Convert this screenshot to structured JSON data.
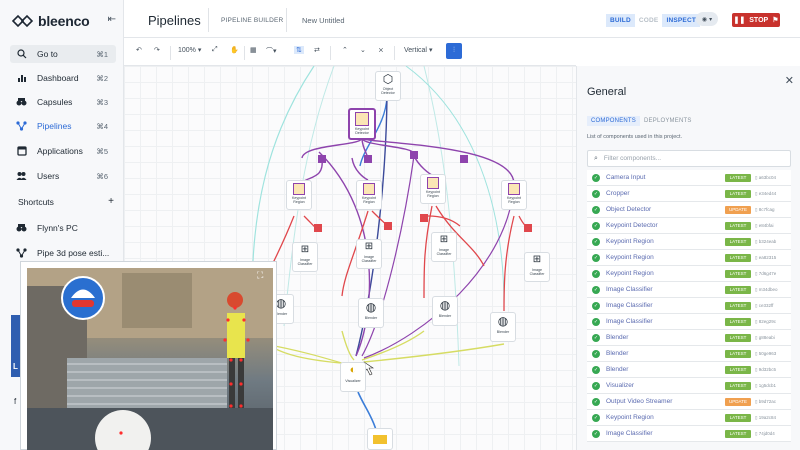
{
  "app": {
    "name": "bleenco"
  },
  "sidebar": {
    "items": [
      {
        "label": "Go to",
        "shortcut": "⌘1"
      },
      {
        "label": "Dashboard",
        "shortcut": "⌘2"
      },
      {
        "label": "Capsules",
        "shortcut": "⌘3"
      },
      {
        "label": "Pipelines",
        "shortcut": "⌘4"
      },
      {
        "label": "Applications",
        "shortcut": "⌘5"
      },
      {
        "label": "Users",
        "shortcut": "⌘6"
      }
    ],
    "shortcuts_label": "Shortcuts",
    "shortcuts_add": "+",
    "shortcuts": [
      {
        "label": "Flynn's PC"
      },
      {
        "label": "Pipe 3d pose esti..."
      }
    ],
    "partial_letter": "f"
  },
  "header": {
    "title": "Pipelines",
    "builder_label": "PIPELINE BUILDER",
    "doc_name": "New Untitled",
    "modes": [
      "BUILD",
      "CODE",
      "INSPECT"
    ],
    "stop_label": "STOP"
  },
  "toolbar": {
    "zoom": "100%",
    "layout": "Vertical"
  },
  "canvas": {
    "nodes": [
      {
        "id": "obj",
        "label": "Object Detector"
      },
      {
        "id": "kpd",
        "label": "Keypoint Detector"
      },
      {
        "id": "kr1",
        "label": "Keypoint Region"
      },
      {
        "id": "kr2",
        "label": "Keypoint Region"
      },
      {
        "id": "kr3",
        "label": "Keypoint Region"
      },
      {
        "id": "kr4",
        "label": "Keypoint Region"
      },
      {
        "id": "ic1",
        "label": "Image Classifier"
      },
      {
        "id": "ic2",
        "label": "Image Classifier"
      },
      {
        "id": "ic3",
        "label": "Image Classifier"
      },
      {
        "id": "ic4",
        "label": "Image Classifier"
      },
      {
        "id": "bl0",
        "label": "Blender"
      },
      {
        "id": "bl1",
        "label": "Blender"
      },
      {
        "id": "bl2",
        "label": "Blender"
      },
      {
        "id": "bl3",
        "label": "Blender"
      },
      {
        "id": "vis",
        "label": "Visualizer"
      }
    ],
    "colors": {
      "purple": "#8e44ad",
      "red": "#e0474c",
      "blue": "#3b7dd8",
      "yellow": "#d6dc63",
      "teal": "#7fd3d0"
    }
  },
  "panel": {
    "title": "General",
    "tabs": [
      "COMPONENTS",
      "DEPLOYMENTS"
    ],
    "description": "List of components used in this project.",
    "filter_placeholder": "Filter components...",
    "components": [
      {
        "name": "Camera Input",
        "badge": "LATEST",
        "hash": "a63bc04"
      },
      {
        "name": "Cropper",
        "badge": "LATEST",
        "hash": "e34ed44"
      },
      {
        "name": "Object Detector",
        "badge": "UPDATE",
        "hash": "8c7fcag"
      },
      {
        "name": "Keypoint Detector",
        "badge": "LATEST",
        "hash": "e84bfai"
      },
      {
        "name": "Keypoint Region",
        "badge": "LATEST",
        "hash": "b324eab"
      },
      {
        "name": "Keypoint Region",
        "badge": "LATEST",
        "hash": "ea82315"
      },
      {
        "name": "Keypoint Region",
        "badge": "LATEST",
        "hash": "7d6g47e"
      },
      {
        "name": "Image Classifier",
        "badge": "LATEST",
        "hash": "m34dbeo"
      },
      {
        "name": "Image Classifier",
        "badge": "LATEST",
        "hash": "ce332ff"
      },
      {
        "name": "Image Classifier",
        "badge": "LATEST",
        "hash": "82eg29c"
      },
      {
        "name": "Blender",
        "badge": "LATEST",
        "hash": "g88eabi"
      },
      {
        "name": "Blender",
        "badge": "LATEST",
        "hash": "50ge963"
      },
      {
        "name": "Blender",
        "badge": "LATEST",
        "hash": "9d32bc5"
      },
      {
        "name": "Visualizer",
        "badge": "LATEST",
        "hash": "1g5dcb1"
      },
      {
        "name": "Output Video Streamer",
        "badge": "UPDATE",
        "hash": "b9d72ac"
      },
      {
        "name": "Keypoint Region",
        "badge": "LATEST",
        "hash": "19a2c84"
      },
      {
        "name": "Image Classifier",
        "badge": "LATEST",
        "hash": "74jd0d4"
      }
    ],
    "badge_colors": {
      "LATEST": "#7ab648",
      "UPDATE": "#f0a050"
    }
  },
  "overlay": {
    "blue_letter": "L"
  }
}
